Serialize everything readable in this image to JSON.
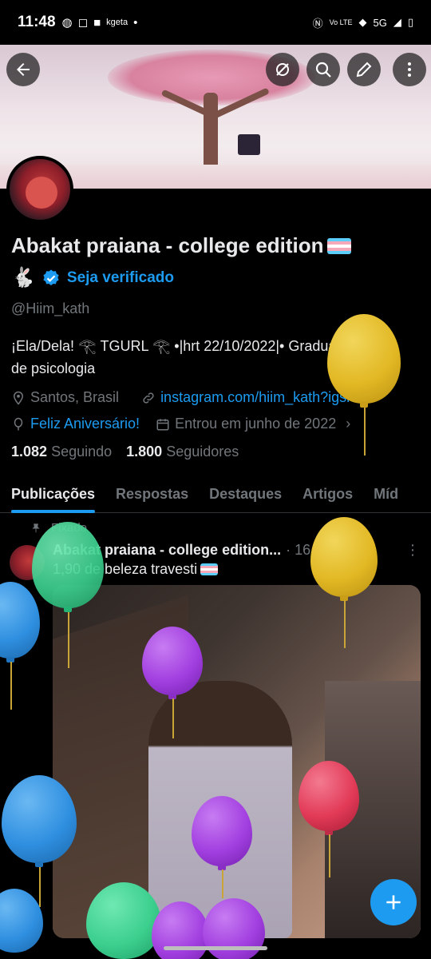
{
  "statusbar": {
    "time": "11:48",
    "carrier_text": "kgeta",
    "network": "5G",
    "volte": "Vo LTE"
  },
  "header": {
    "back_icon": "arrow-left-icon",
    "actions": [
      "sync-off-icon",
      "search-icon",
      "edit-icon",
      "more-vertical-icon"
    ]
  },
  "profile": {
    "name": "Abakat praiana - college edition",
    "rabbit": "🐇",
    "verified_label": "Seja verificado",
    "handle": "@Hiim_kath",
    "bio_line1": "¡Ela/Dela! 𓂀 TGURL 𓂀 •|hrt 22/10/2022|• Graduanda",
    "bio_line2": "de psicologia",
    "location": "Santos, Brasil",
    "website": "instagram.com/hiim_kath?igsh...",
    "birthday": "Feliz Aniversário!",
    "joined": "Entrou em junho de 2022",
    "following_count": "1.082",
    "following_label": "Seguindo",
    "followers_count": "1.800",
    "followers_label": "Seguidores"
  },
  "tabs": [
    {
      "label": "Publicações",
      "active": true
    },
    {
      "label": "Respostas",
      "active": false
    },
    {
      "label": "Destaques",
      "active": false
    },
    {
      "label": "Artigos",
      "active": false
    },
    {
      "label": "Míd",
      "active": false
    }
  ],
  "post": {
    "pinned_label": "Fixado",
    "author": "Abakat praiana - college edition...",
    "date": "· 16 jun. 23",
    "text": "1,90 de beleza travesti"
  },
  "colors": {
    "accent": "#1d9bf0",
    "background": "#000000",
    "muted": "#71767b",
    "balloon_yellow": "#e2b824",
    "balloon_green": "#3ccf8e",
    "balloon_purple": "#a23fe0",
    "balloon_red": "#e23a57",
    "balloon_blue": "#2f8fe0"
  }
}
